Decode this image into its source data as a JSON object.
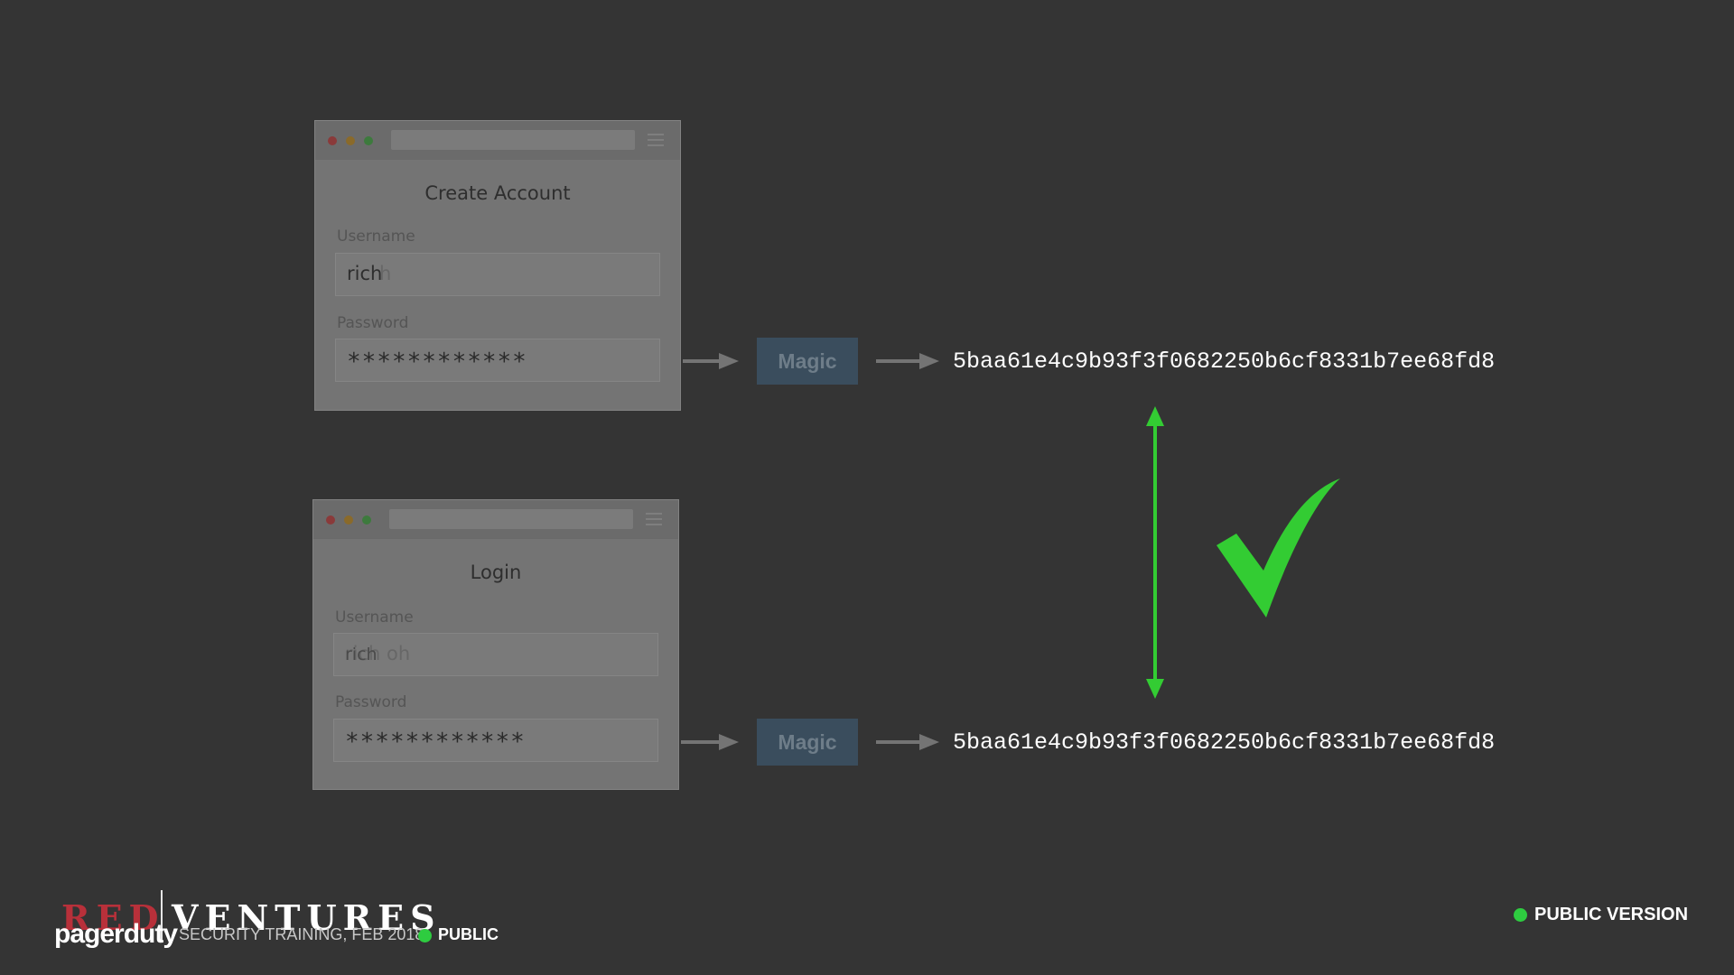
{
  "create_window": {
    "title": "Create Account",
    "username_label": "Username",
    "username_value": "rich",
    "username_placeholder_ghost": "h",
    "password_label": "Password",
    "password_value": "************"
  },
  "login_window": {
    "title": "Login",
    "username_label": "Username",
    "username_overlap_text": "rich",
    "username_placeholder_ghost": "rich oh",
    "password_label": "Password",
    "password_value": "************"
  },
  "magic_label": "Magic",
  "hash_top": "5baa61e4c9b93f3f0682250b6cf8331b7ee68fd8",
  "hash_bottom": "5baa61e4c9b93f3f0682250b6cf8331b7ee68fd8",
  "colors": {
    "background": "#343434",
    "checkmark": "#33cc33",
    "magic_box": "#3a4d5d",
    "public_dot": "#2ecc40"
  },
  "footer": {
    "brand_red": "RED",
    "brand_white": "VENTURES",
    "pagerduty": "pagerduty",
    "subtitle": "SECURITY TRAINING, FEB 2018",
    "public_badge": "PUBLIC",
    "public_version": "PUBLIC VERSION"
  }
}
